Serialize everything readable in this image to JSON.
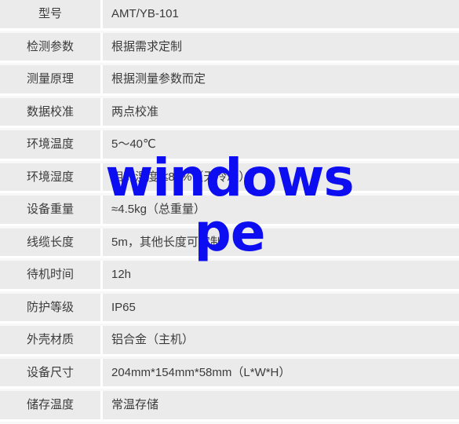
{
  "watermark": {
    "line1": "windows",
    "line2": "pe",
    "color": "#0d0df2"
  },
  "theme": {
    "row_background": "#ebebeb",
    "row_separator": "#f8f8f8",
    "text_color": "#3b3b3b",
    "page_background": "#ffffff"
  },
  "spec_table": {
    "rows": [
      {
        "label": "型号",
        "value": "AMT/YB-101"
      },
      {
        "label": "检测参数",
        "value": "根据需求定制"
      },
      {
        "label": "测量原理",
        "value": "根据测量参数而定"
      },
      {
        "label": "数据校准",
        "value": "两点校准"
      },
      {
        "label": "环境温度",
        "value": "5～40℃"
      },
      {
        "label": "环境湿度",
        "value": "相对湿度 ≤85%（无冷凝）"
      },
      {
        "label": "设备重量",
        "value": "≈4.5kg（总重量）"
      },
      {
        "label": "线缆长度",
        "value": "5m，其他长度可定制"
      },
      {
        "label": "待机时间",
        "value": "12h"
      },
      {
        "label": "防护等级",
        "value": "IP65"
      },
      {
        "label": "外壳材质",
        "value": "铝合金（主机）"
      },
      {
        "label": "设备尺寸",
        "value": "204mm*154mm*58mm（L*W*H）"
      },
      {
        "label": "储存温度",
        "value": "常温存储"
      }
    ]
  }
}
